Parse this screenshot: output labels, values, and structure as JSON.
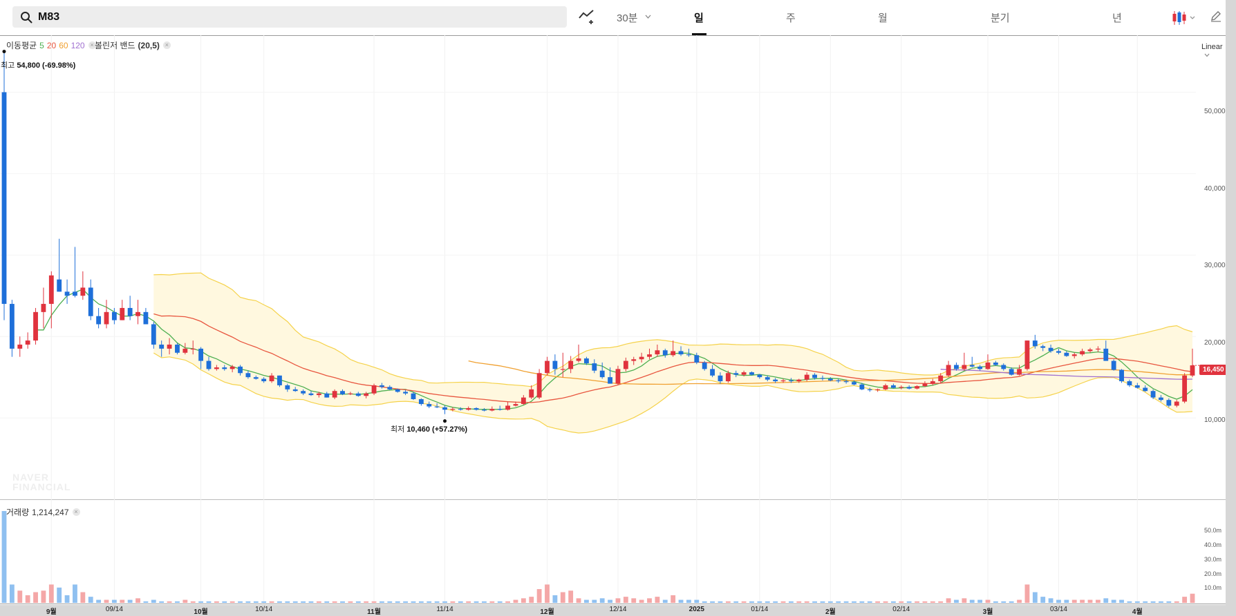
{
  "search": {
    "code": "M83"
  },
  "toolbar": {
    "interval": "30분",
    "tabs": [
      {
        "label": "일",
        "active": true
      },
      {
        "label": "주",
        "active": false
      },
      {
        "label": "월",
        "active": false
      },
      {
        "label": "분기",
        "active": false
      },
      {
        "label": "년",
        "active": false
      }
    ],
    "icons": [
      "indicator-add-icon",
      "chevron-down-icon",
      "candlestick-type-icon",
      "pencil-icon"
    ]
  },
  "indicators": {
    "ma_label": "이동평균",
    "ma_periods": [
      {
        "value": "5",
        "color": "#4caf50"
      },
      {
        "value": "20",
        "color": "#e8553e"
      },
      {
        "value": "60",
        "color": "#f0a030"
      },
      {
        "value": "120",
        "color": "#a070d0"
      }
    ],
    "bollinger_label": "볼린저 밴드",
    "bollinger_params": "(20,5)"
  },
  "scale_mode": "Linear",
  "high": {
    "prefix": "최고",
    "value": "54,800",
    "change": "(-69.98%)"
  },
  "low": {
    "prefix": "최저",
    "value": "10,460",
    "change": "(+57.27%)"
  },
  "current_price": "16,450",
  "watermark": [
    "NAVER",
    "FINANCIAL"
  ],
  "volume": {
    "label": "거래량",
    "value": "1,214,247"
  },
  "colors": {
    "up": "#e0333e",
    "down": "#1e6fd9",
    "band_fill": "#fff8df",
    "band_line": "#f5d24a",
    "up_volume": "#f4a7a7",
    "down_volume": "#8fc0f0"
  },
  "chart_data": {
    "type": "candlestick",
    "price_axis": {
      "ticks": [
        10000,
        20000,
        30000,
        40000,
        50000
      ],
      "tick_labels": [
        "10,000",
        "20,000",
        "30,000",
        "40,000",
        "50,000"
      ],
      "ylim": [
        0,
        57000
      ]
    },
    "volume_axis": {
      "ticks": [
        10,
        20,
        30,
        40,
        50
      ],
      "tick_labels": [
        "10.0m",
        "20.0m",
        "30.0m",
        "40.0m",
        "50.0m"
      ],
      "ylim": [
        0,
        60
      ]
    },
    "x_labels": [
      {
        "label": "9월",
        "day": 6,
        "month": true
      },
      {
        "label": "09/14",
        "day": 14,
        "month": false
      },
      {
        "label": "10월",
        "day": 25,
        "month": true
      },
      {
        "label": "10/14",
        "day": 33,
        "month": false
      },
      {
        "label": "11월",
        "day": 47,
        "month": true
      },
      {
        "label": "11/14",
        "day": 56,
        "month": false
      },
      {
        "label": "12월",
        "day": 69,
        "month": true
      },
      {
        "label": "12/14",
        "day": 78,
        "month": false
      },
      {
        "label": "2025",
        "day": 88,
        "month": true
      },
      {
        "label": "01/14",
        "day": 96,
        "month": false
      },
      {
        "label": "2월",
        "day": 105,
        "month": true
      },
      {
        "label": "02/14",
        "day": 114,
        "month": false
      },
      {
        "label": "3월",
        "day": 125,
        "month": true
      },
      {
        "label": "03/14",
        "day": 134,
        "month": false
      },
      {
        "label": "4월",
        "day": 144,
        "month": true
      }
    ],
    "candles": [
      [
        50000,
        55000,
        22000,
        24000,
        65
      ],
      [
        24000,
        24500,
        17500,
        18500,
        12
      ],
      [
        18500,
        20000,
        17500,
        19000,
        8
      ],
      [
        19000,
        20500,
        18500,
        19500,
        5
      ],
      [
        19500,
        23500,
        19000,
        23000,
        7
      ],
      [
        23000,
        26000,
        21000,
        24000,
        8
      ],
      [
        24000,
        28000,
        21000,
        27500,
        12
      ],
      [
        27000,
        32000,
        25500,
        25500,
        10
      ],
      [
        25500,
        27000,
        24000,
        25000,
        5
      ],
      [
        25500,
        31000,
        24800,
        25000,
        12
      ],
      [
        25000,
        28000,
        24500,
        26000,
        7
      ],
      [
        26000,
        27000,
        22000,
        22500,
        4
      ],
      [
        22500,
        23500,
        21000,
        21500,
        2
      ],
      [
        21500,
        24500,
        21000,
        23000,
        2
      ],
      [
        23000,
        23500,
        21500,
        22000,
        2
      ],
      [
        22000,
        24500,
        22000,
        23500,
        2
      ],
      [
        23500,
        25000,
        22000,
        22500,
        2
      ],
      [
        22500,
        24500,
        21500,
        23000,
        3
      ],
      [
        23000,
        23500,
        21500,
        21500,
        1
      ],
      [
        21500,
        21800,
        18500,
        19000,
        2
      ],
      [
        19000,
        19500,
        17500,
        18500,
        1
      ],
      [
        18500,
        19800,
        17800,
        19000,
        1
      ],
      [
        19000,
        19200,
        17800,
        18000,
        1
      ],
      [
        18000,
        19200,
        17800,
        18500,
        2
      ],
      [
        18500,
        19500,
        17800,
        18500,
        1
      ],
      [
        18500,
        18700,
        16000,
        17000,
        1
      ],
      [
        17000,
        17500,
        15800,
        16000,
        1
      ],
      [
        16000,
        16500,
        15800,
        16200,
        1
      ],
      [
        16200,
        16500,
        15800,
        16000,
        1
      ],
      [
        16000,
        16500,
        15600,
        16300,
        1
      ],
      [
        16300,
        16500,
        15200,
        15500,
        1
      ],
      [
        15500,
        15800,
        14800,
        15000,
        1
      ],
      [
        15000,
        15200,
        14700,
        14800,
        1
      ],
      [
        14800,
        15000,
        14300,
        14500,
        1
      ],
      [
        14500,
        15500,
        14300,
        15200,
        1
      ],
      [
        15200,
        15200,
        13800,
        14000,
        1
      ],
      [
        14000,
        14200,
        13200,
        13500,
        1
      ],
      [
        13500,
        13800,
        13200,
        13300,
        1
      ],
      [
        13300,
        13500,
        12800,
        13000,
        1
      ],
      [
        13000,
        13300,
        12700,
        12800,
        1
      ],
      [
        12800,
        13200,
        12500,
        13000,
        1
      ],
      [
        13000,
        13200,
        12500,
        12500,
        1
      ],
      [
        12500,
        13500,
        12300,
        13300,
        1
      ],
      [
        13300,
        13500,
        12800,
        12900,
        1
      ],
      [
        12900,
        13200,
        12800,
        13000,
        1
      ],
      [
        13000,
        13200,
        12600,
        12700,
        1
      ],
      [
        12700,
        13200,
        12400,
        13000,
        1
      ],
      [
        13000,
        14200,
        12800,
        14000,
        1
      ],
      [
        14000,
        14300,
        13600,
        13800,
        1
      ],
      [
        13800,
        14000,
        13400,
        13500,
        1
      ],
      [
        13500,
        13600,
        13100,
        13200,
        1
      ],
      [
        13200,
        13400,
        12800,
        13000,
        1
      ],
      [
        13000,
        13200,
        12200,
        12300,
        1
      ],
      [
        12300,
        12400,
        11500,
        11700,
        1
      ],
      [
        11700,
        12000,
        11200,
        11400,
        1
      ],
      [
        11400,
        11800,
        11200,
        11300,
        1
      ],
      [
        11300,
        11500,
        10460,
        11000,
        1
      ],
      [
        11000,
        11300,
        10800,
        11100,
        1
      ],
      [
        11100,
        11300,
        10900,
        11000,
        1
      ],
      [
        11000,
        11400,
        10900,
        11200,
        1
      ],
      [
        11200,
        11300,
        10900,
        11000,
        1
      ],
      [
        11000,
        11200,
        10800,
        10900,
        1
      ],
      [
        10900,
        11400,
        10800,
        11100,
        1
      ],
      [
        11100,
        11500,
        10900,
        11000,
        1
      ],
      [
        11000,
        12000,
        10900,
        11500,
        1
      ],
      [
        11500,
        12000,
        11400,
        11700,
        2
      ],
      [
        11700,
        12800,
        11600,
        12500,
        3
      ],
      [
        12500,
        14000,
        12300,
        13500,
        4
      ],
      [
        12500,
        16000,
        12300,
        15500,
        9
      ],
      [
        15500,
        17500,
        15200,
        17000,
        12
      ],
      [
        17000,
        17800,
        15300,
        16000,
        5
      ],
      [
        16000,
        18000,
        15000,
        16000,
        7
      ],
      [
        16000,
        17600,
        15500,
        17000,
        8
      ],
      [
        17000,
        19000,
        16800,
        17300,
        3
      ],
      [
        17300,
        17500,
        16500,
        16700,
        2
      ],
      [
        16700,
        17200,
        15500,
        15800,
        2
      ],
      [
        15800,
        16800,
        14800,
        15000,
        3
      ],
      [
        15000,
        16200,
        14200,
        14200,
        2
      ],
      [
        14200,
        16400,
        14000,
        16000,
        3
      ],
      [
        16000,
        17400,
        15700,
        17000,
        4
      ],
      [
        17000,
        17500,
        16500,
        17200,
        3
      ],
      [
        17200,
        18000,
        16800,
        17500,
        2
      ],
      [
        17500,
        18500,
        17200,
        17800,
        3
      ],
      [
        17800,
        19000,
        17500,
        18300,
        4
      ],
      [
        18300,
        18500,
        17400,
        17700,
        2
      ],
      [
        17700,
        19500,
        17500,
        18200,
        5
      ],
      [
        18200,
        18800,
        17600,
        17800,
        2
      ],
      [
        17800,
        18500,
        17500,
        17700,
        2
      ],
      [
        17700,
        18000,
        16600,
        16800,
        2
      ],
      [
        16800,
        17000,
        15800,
        16000,
        1
      ],
      [
        16000,
        16500,
        15000,
        15200,
        1
      ],
      [
        15200,
        15600,
        14200,
        14500,
        1
      ],
      [
        14500,
        15800,
        14300,
        15500,
        1
      ],
      [
        15500,
        15800,
        15000,
        15300,
        1
      ],
      [
        15300,
        15800,
        15100,
        15600,
        1
      ],
      [
        15600,
        15700,
        15200,
        15300,
        1
      ],
      [
        15300,
        15400,
        14800,
        15000,
        1
      ],
      [
        15000,
        15200,
        14500,
        14700,
        1
      ],
      [
        14700,
        14900,
        14300,
        14500,
        1
      ],
      [
        14500,
        14800,
        14300,
        14600,
        1
      ],
      [
        14600,
        14900,
        14300,
        14500,
        1
      ],
      [
        14500,
        14800,
        14300,
        14700,
        1
      ],
      [
        14700,
        15600,
        14500,
        15300,
        1
      ],
      [
        15300,
        15500,
        14700,
        14900,
        1
      ],
      [
        14900,
        15200,
        14600,
        14800,
        1
      ],
      [
        14800,
        15000,
        14500,
        14600,
        1
      ],
      [
        14600,
        14800,
        14300,
        14500,
        1
      ],
      [
        14500,
        14700,
        14200,
        14400,
        1
      ],
      [
        14400,
        14600,
        14000,
        14100,
        1
      ],
      [
        14100,
        14300,
        13400,
        13500,
        1
      ],
      [
        13500,
        13700,
        13200,
        13400,
        1
      ],
      [
        13400,
        13600,
        13200,
        13500,
        1
      ],
      [
        13500,
        14200,
        13400,
        14000,
        1
      ],
      [
        14000,
        14200,
        13600,
        13700,
        1
      ],
      [
        13700,
        14000,
        13500,
        13800,
        1
      ],
      [
        13800,
        14000,
        13500,
        13600,
        1
      ],
      [
        13600,
        14000,
        13500,
        13900,
        1
      ],
      [
        13900,
        14500,
        13800,
        14200,
        1
      ],
      [
        14200,
        14800,
        14000,
        14500,
        1
      ],
      [
        14500,
        15500,
        14200,
        15200,
        1
      ],
      [
        15200,
        17000,
        15000,
        16500,
        3
      ],
      [
        16500,
        16800,
        15800,
        16000,
        2
      ],
      [
        16000,
        18000,
        15800,
        16500,
        3
      ],
      [
        16500,
        17500,
        16200,
        16300,
        2
      ],
      [
        16300,
        16500,
        15800,
        16000,
        2
      ],
      [
        16000,
        17800,
        15900,
        16800,
        2
      ],
      [
        16800,
        17000,
        16400,
        16500,
        1
      ],
      [
        16500,
        16700,
        15800,
        16000,
        1
      ],
      [
        16000,
        16200,
        15200,
        15300,
        1
      ],
      [
        15300,
        16500,
        15200,
        16000,
        2
      ],
      [
        16000,
        19500,
        15800,
        19500,
        12
      ],
      [
        19500,
        20200,
        18500,
        18800,
        7
      ],
      [
        18800,
        19000,
        18200,
        18600,
        4
      ],
      [
        18600,
        19000,
        18000,
        18200,
        3
      ],
      [
        18200,
        18500,
        17800,
        18000,
        2
      ],
      [
        18000,
        18200,
        17500,
        17600,
        2
      ],
      [
        17600,
        18000,
        17300,
        17800,
        2
      ],
      [
        17800,
        18500,
        17600,
        18200,
        2
      ],
      [
        18200,
        18600,
        18000,
        18400,
        2
      ],
      [
        18400,
        18800,
        18100,
        18500,
        2
      ],
      [
        18500,
        19500,
        17000,
        17000,
        3
      ],
      [
        17000,
        17200,
        15800,
        15900,
        2
      ],
      [
        15900,
        16000,
        14300,
        14500,
        2
      ],
      [
        14500,
        14700,
        13800,
        14000,
        1
      ],
      [
        14000,
        14300,
        13600,
        13700,
        1
      ],
      [
        13700,
        14000,
        13200,
        13300,
        1
      ],
      [
        13300,
        13500,
        12300,
        12500,
        1
      ],
      [
        12500,
        12800,
        12000,
        12200,
        1
      ],
      [
        12200,
        12400,
        11300,
        11500,
        1
      ],
      [
        11500,
        12200,
        11300,
        12000,
        1
      ],
      [
        12000,
        15500,
        11800,
        15200,
        4
      ],
      [
        15200,
        18500,
        15000,
        16450,
        6
      ]
    ]
  }
}
